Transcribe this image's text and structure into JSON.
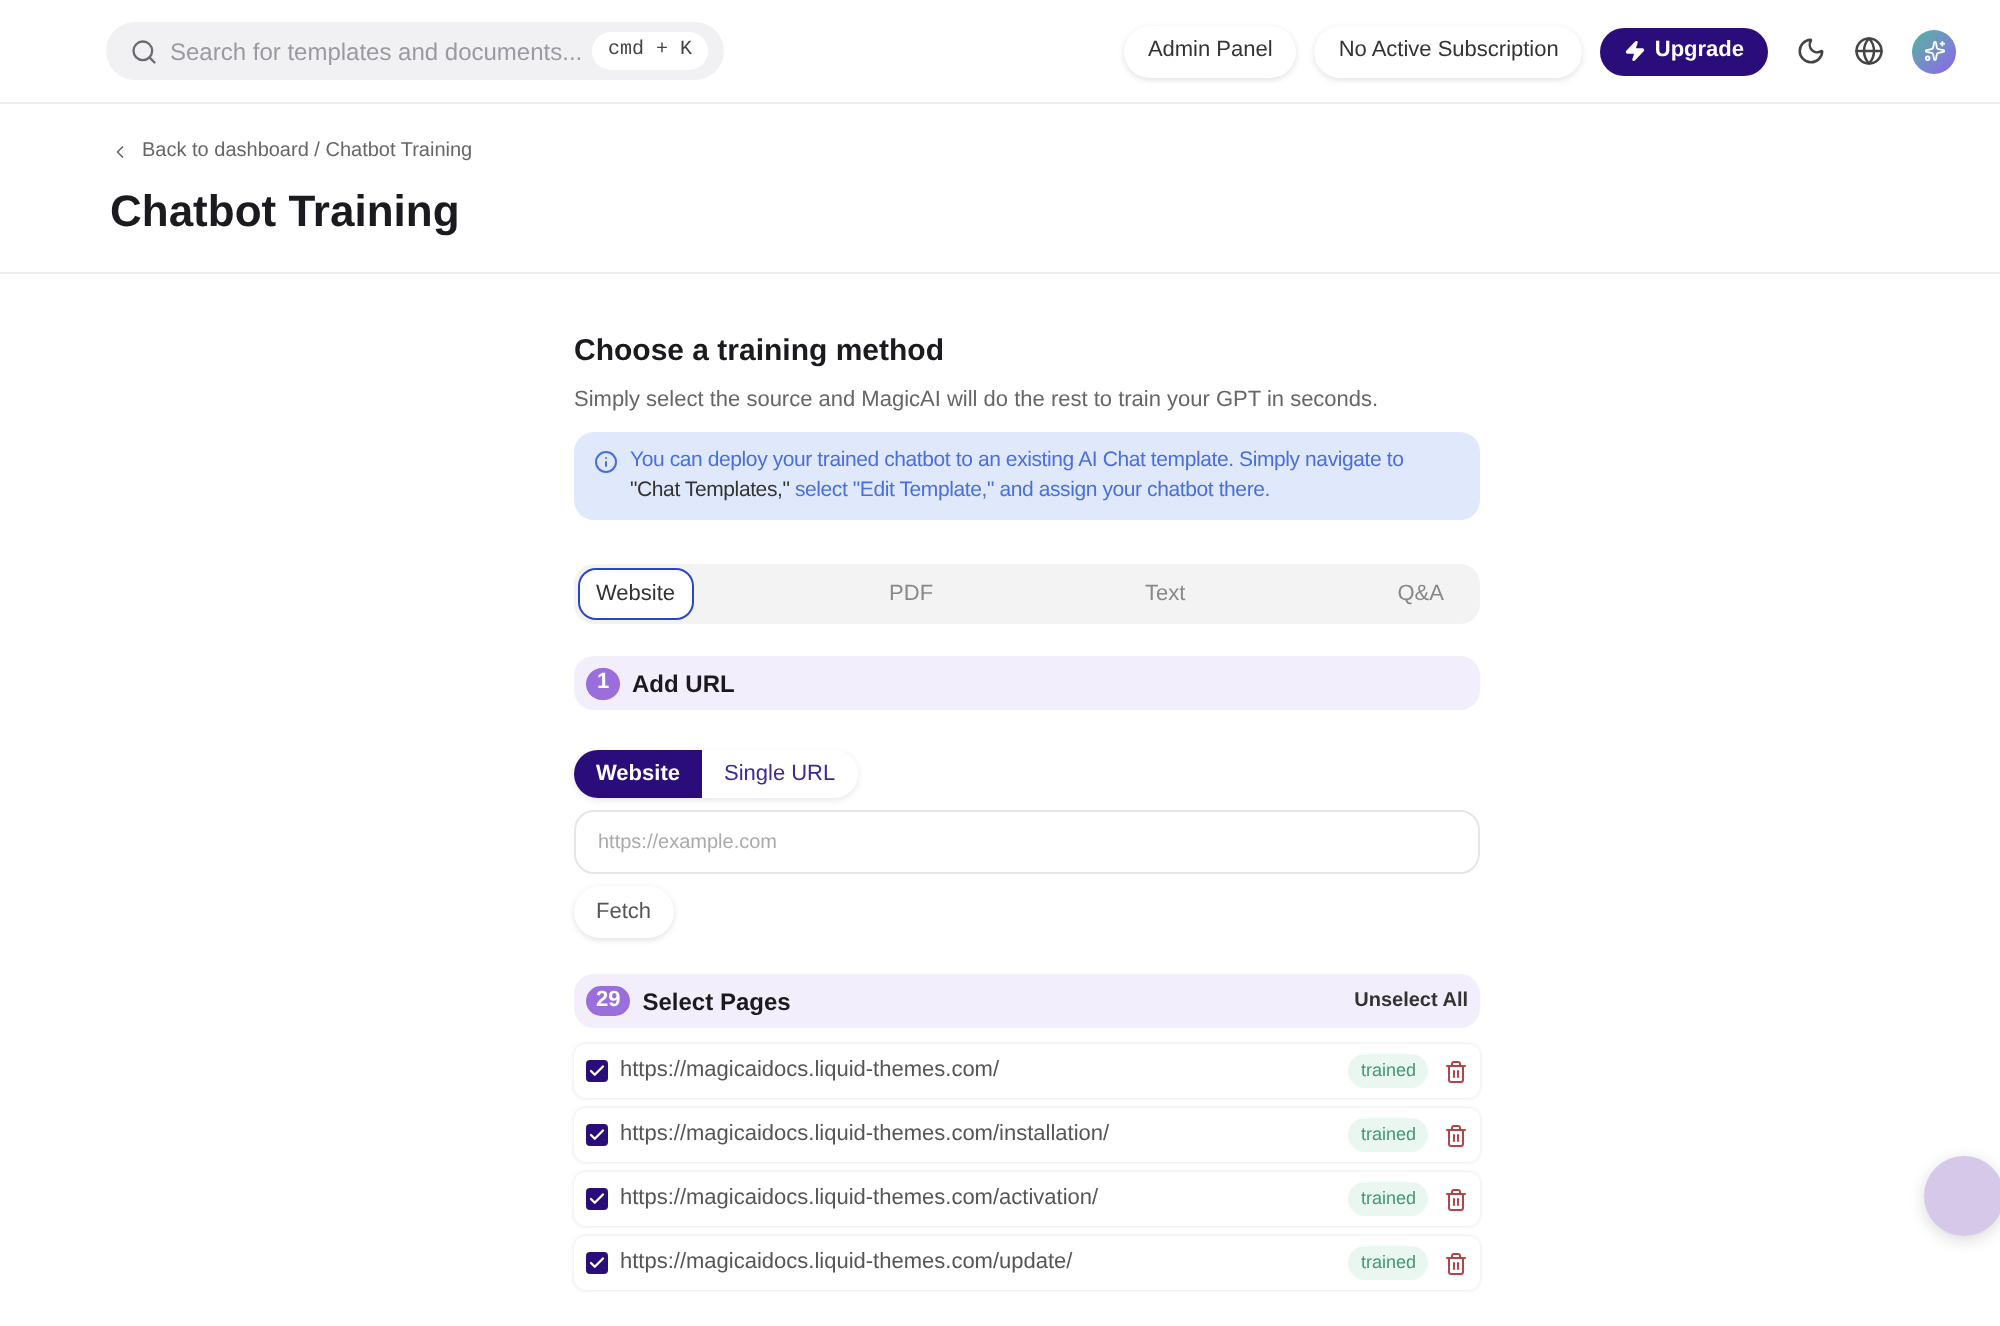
{
  "header": {
    "search": {
      "placeholder": "Search for templates and documents...",
      "shortcut": "cmd + K"
    },
    "admin_panel": "Admin Panel",
    "subscription": "No Active Subscription",
    "upgrade": "Upgrade"
  },
  "breadcrumb": "Back to dashboard / Chatbot Training",
  "page_title": "Chatbot Training",
  "section": {
    "title": "Choose a training method",
    "subtitle": "Simply select the source and MagicAI will do the rest to train your GPT in seconds.",
    "note": [
      {
        "text": "You can deploy your trained chatbot to an existing AI Chat template. Simply navigate to ",
        "emphasis": false
      },
      {
        "text": "\"Chat Templates,\"",
        "emphasis": true
      },
      {
        "text": " select \"Edit Template,\" and assign your chatbot there.",
        "emphasis": false
      }
    ]
  },
  "method_tabs": [
    {
      "label": "Website",
      "selected": true
    },
    {
      "label": "PDF",
      "selected": false
    },
    {
      "label": "Text",
      "selected": false
    },
    {
      "label": "Q&A",
      "selected": false
    }
  ],
  "add_url": {
    "step": "1",
    "title": "Add URL",
    "source_toggle": [
      {
        "label": "Website",
        "selected": true
      },
      {
        "label": "Single URL",
        "selected": false
      }
    ],
    "url_field": {
      "placeholder": "https://example.com"
    },
    "fetch": "Fetch"
  },
  "pages": {
    "count": "29",
    "title": "Select Pages",
    "unselect_all": "Unselect All",
    "rows": [
      {
        "url": "https://magicaidocs.liquid-themes.com/",
        "checked": true,
        "status": "trained"
      },
      {
        "url": "https://magicaidocs.liquid-themes.com/installation/",
        "checked": true,
        "status": "trained"
      },
      {
        "url": "https://magicaidocs.liquid-themes.com/activation/",
        "checked": true,
        "status": "trained"
      },
      {
        "url": "https://magicaidocs.liquid-themes.com/update/",
        "checked": true,
        "status": "trained"
      }
    ]
  }
}
